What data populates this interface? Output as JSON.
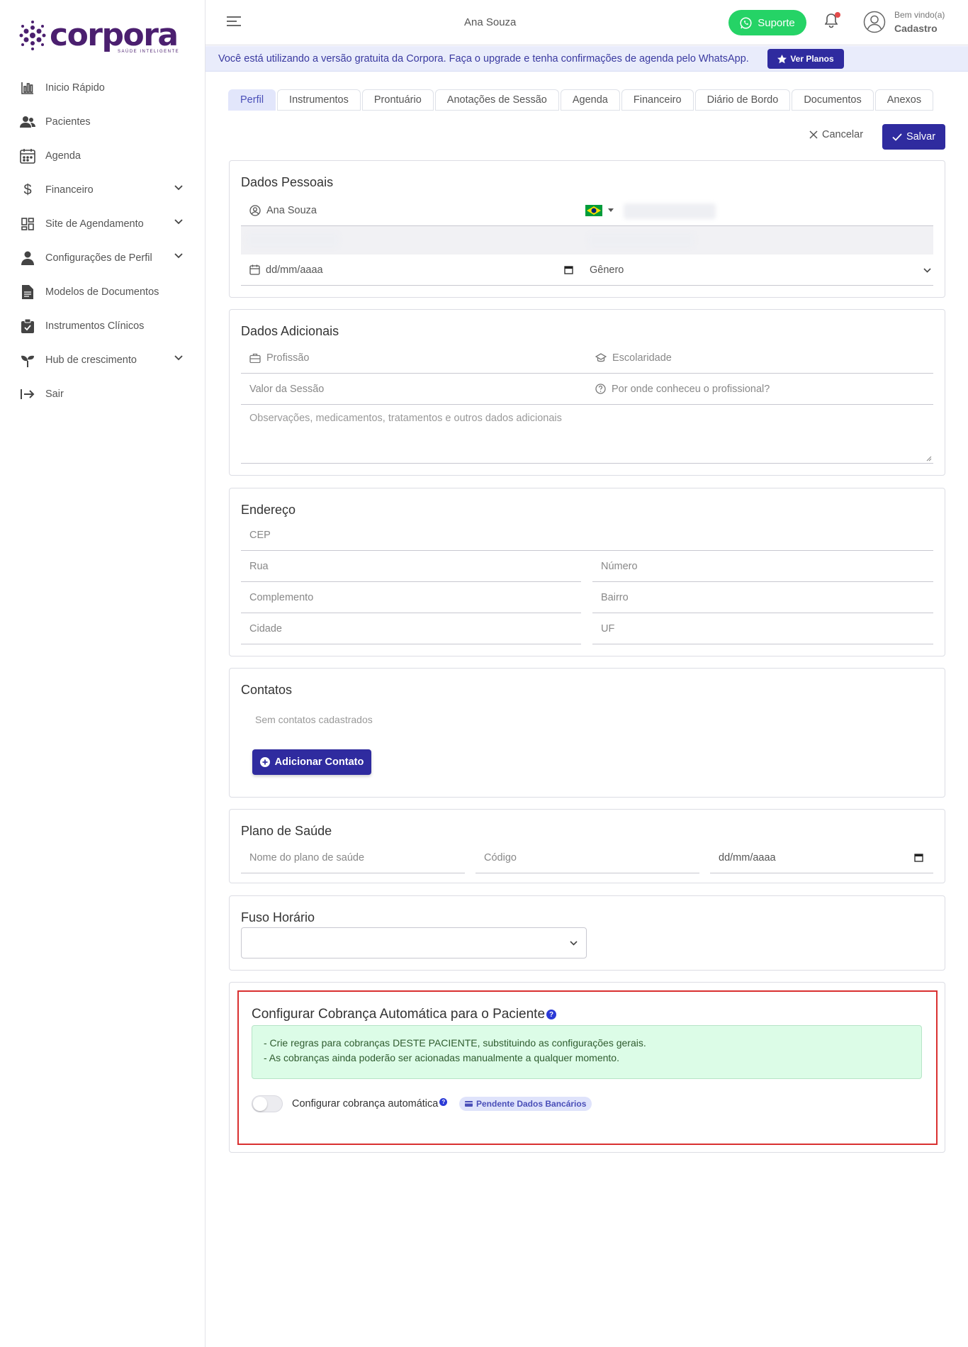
{
  "logo": {
    "text": "corpora",
    "tagline": "SAÚDE INTELIGENTE"
  },
  "sidebar": {
    "items": [
      {
        "label": "Inicio Rápido",
        "icon": "chart-icon",
        "expandable": false
      },
      {
        "label": "Pacientes",
        "icon": "users-icon",
        "expandable": false
      },
      {
        "label": "Agenda",
        "icon": "calendar-icon",
        "expandable": false
      },
      {
        "label": "Financeiro",
        "icon": "dollar-icon",
        "expandable": true
      },
      {
        "label": "Site de Agendamento",
        "icon": "dashboard-icon",
        "expandable": true
      },
      {
        "label": "Configurações de Perfil",
        "icon": "user-icon",
        "expandable": true
      },
      {
        "label": "Modelos de Documentos",
        "icon": "document-icon",
        "expandable": false
      },
      {
        "label": "Instrumentos Clínicos",
        "icon": "clipboard-icon",
        "expandable": false
      },
      {
        "label": "Hub de crescimento",
        "icon": "sprout-icon",
        "expandable": true
      },
      {
        "label": "Sair",
        "icon": "logout-icon",
        "expandable": false
      }
    ]
  },
  "header": {
    "patient_name": "Ana Souza",
    "support_label": "Suporte",
    "welcome": "Bem vindo(a)",
    "username": "Cadastro"
  },
  "banner": {
    "text": "Você está utilizando a versão gratuita da Corpora. Faça o upgrade e tenha confirmações de agenda pelo WhatsApp.",
    "button_label": "Ver Planos"
  },
  "tabs": [
    "Perfil",
    "Instrumentos",
    "Prontuário",
    "Anotações de Sessão",
    "Agenda",
    "Financeiro",
    "Diário de Bordo",
    "Documentos",
    "Anexos"
  ],
  "active_tab": "Perfil",
  "actions": {
    "cancel_label": "Cancelar",
    "save_label": "Salvar"
  },
  "dados_pessoais": {
    "title": "Dados Pessoais",
    "name_value": "Ana Souza",
    "date_placeholder": "dd/mm/aaaa",
    "genero_placeholder": "Gênero"
  },
  "dados_adicionais": {
    "title": "Dados Adicionais",
    "profissao": "Profissão",
    "escolaridade": "Escolaridade",
    "valor_sessao": "Valor da Sessão",
    "por_onde": "Por onde conheceu o profissional?",
    "observacoes": "Observações, medicamentos, tratamentos e outros dados adicionais"
  },
  "endereco": {
    "title": "Endereço",
    "cep": "CEP",
    "rua": "Rua",
    "numero": "Número",
    "complemento": "Complemento",
    "bairro": "Bairro",
    "cidade": "Cidade",
    "uf": "UF"
  },
  "contatos": {
    "title": "Contatos",
    "empty": "Sem contatos cadastrados",
    "add_label": "Adicionar Contato"
  },
  "plano_saude": {
    "title": "Plano de Saúde",
    "nome": "Nome do plano de saúde",
    "codigo": "Código",
    "data": "dd/mm/aaaa"
  },
  "fuso": {
    "title": "Fuso Horário",
    "value": ""
  },
  "cobranca": {
    "title": "Configurar Cobrança Automática para o Paciente",
    "info_line1": "- Crie regras para cobranças DESTE PACIENTE, substituindo as configurações gerais.",
    "info_line2": "- As cobranças ainda poderão ser acionadas manualmente a qualquer momento.",
    "toggle_label": "Configurar cobrança automática",
    "toggle_on": false,
    "badge": "Pendente Dados Bancários"
  },
  "colors": {
    "primary": "#2f2b9f",
    "whatsapp": "#25d366",
    "brand": "#4b1f6f",
    "highlight": "#d93030"
  }
}
